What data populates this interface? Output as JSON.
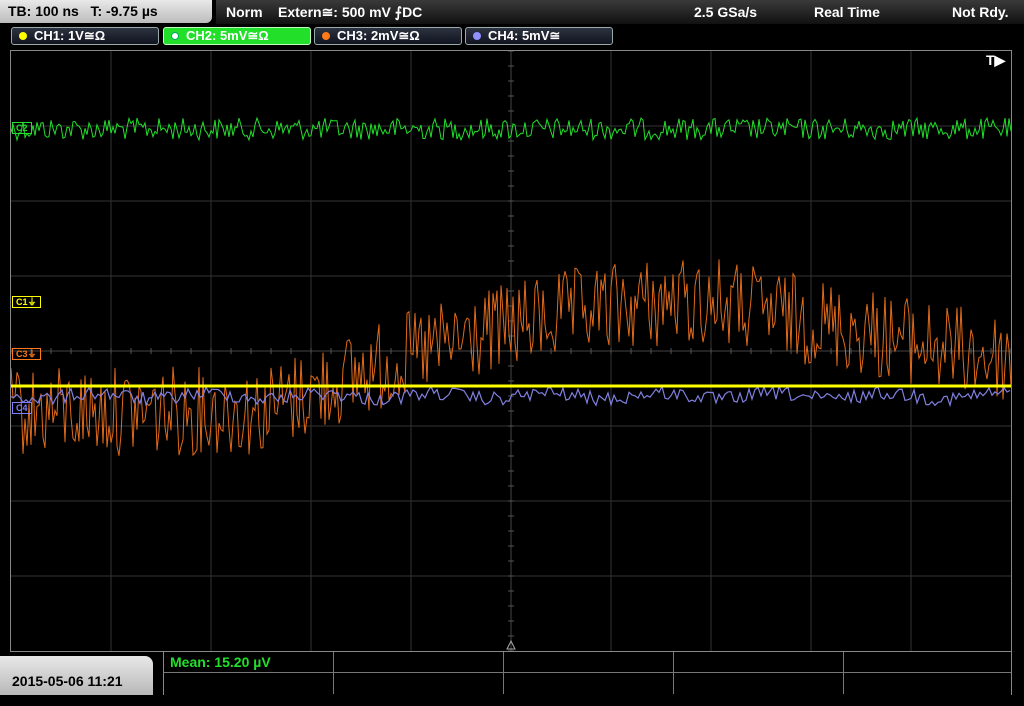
{
  "status": {
    "timebase": "TB: 100 ns",
    "trigger_time": "T: -9.75 µs",
    "mode": "Norm",
    "trigger_source": "Extern≅: 500 mV ⨍DC",
    "sample_rate": "2.5 GSa/s",
    "acq_mode": "Real Time",
    "state": "Not Rdy."
  },
  "channels": [
    {
      "label": "CH1: 1V≅Ω",
      "color": "#ffff00"
    },
    {
      "label": "CH2: 5mV≅Ω",
      "color": "#22e02a"
    },
    {
      "label": "CH3: 2mV≅Ω",
      "color": "#ff7a1a"
    },
    {
      "label": "CH4: 5mV≅",
      "color": "#8080ff"
    }
  ],
  "trigger_flag": "T▶",
  "markers": {
    "c1": "C1⏚",
    "c2": "C2",
    "c3": "C3⏚",
    "c4": "C4"
  },
  "measurement": {
    "mean": "Mean: 15.20 µV"
  },
  "datetime": "2015-05-06 11:21",
  "colors": {
    "ch1": "#ffff00",
    "ch2": "#22e02a",
    "ch3": "#e06a1a",
    "ch4": "#8080e0",
    "grid": "#333333"
  }
}
